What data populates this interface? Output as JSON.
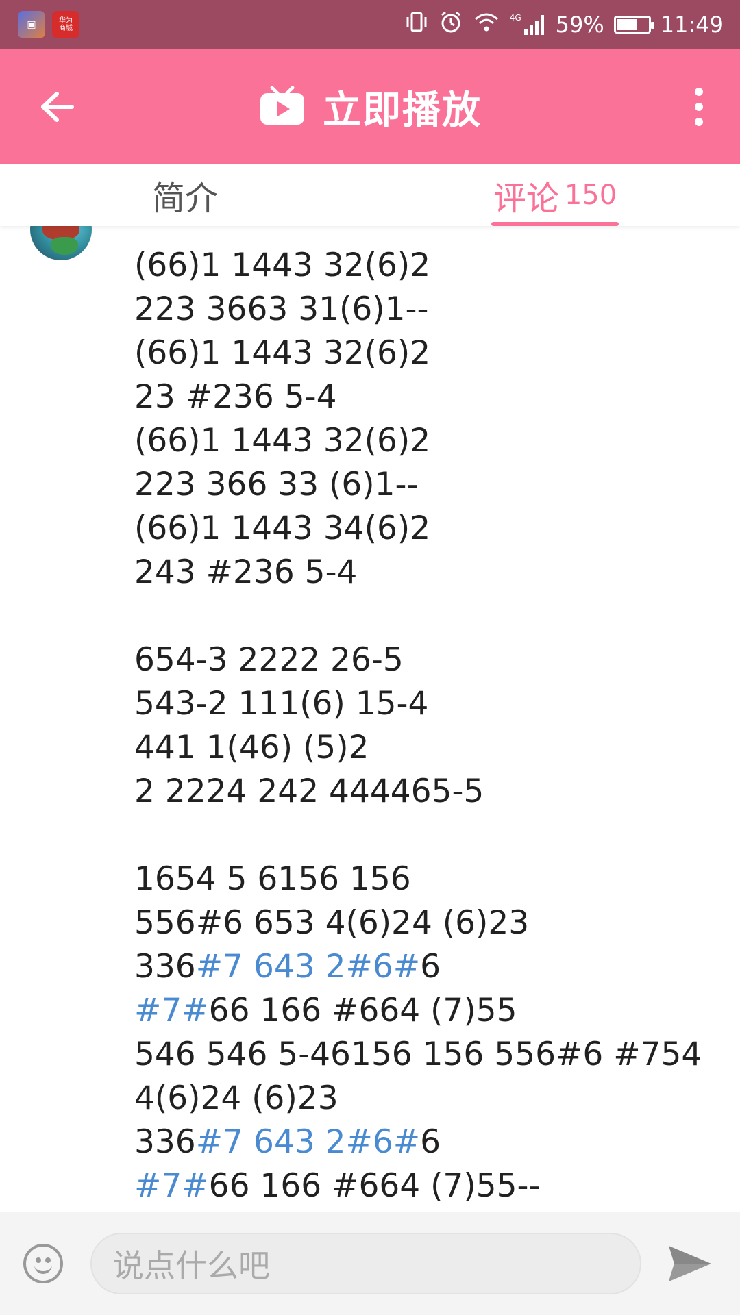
{
  "status_bar": {
    "notif_icon_b_text": "华为商城",
    "battery_percent": "59%",
    "battery_level": 0.59,
    "time": "11:49",
    "network": "4G",
    "icons": [
      "vibrate-icon",
      "alarm-icon",
      "wifi-icon",
      "signal-icon",
      "battery-icon"
    ]
  },
  "app_bar": {
    "title": "立即播放",
    "title_icon": "tv-play-icon",
    "back_icon": "arrow-left-icon",
    "more_icon": "more-vertical-icon",
    "bg_color": "#fb7299"
  },
  "tabs": {
    "intro": "简介",
    "comments": "评论",
    "comments_count": "150",
    "active": "comments"
  },
  "comment": {
    "lines": [
      "(66)1 1443 32(6)2",
      "223 3663 31(6)1--",
      "(66)1 1443 32(6)2",
      "23 #236 5-4",
      "(66)1 1443 32(6)2",
      "223 366 33 (6)1--",
      "(66)1 1443 34(6)2",
      "243 #236 5-4",
      "",
      "654-3 2222 26-5",
      "543-2 111(6) 15-4",
      "441 1(46) (5)2",
      "2 2224 242 444465-5",
      "",
      "1654 5 6156 156",
      "556#6 653 4(6)24 (6)23"
    ],
    "line17_a": "336",
    "line17_link": "#7 643 2#6#",
    "line17_b": "6",
    "line18_link": "#7#",
    "line18_b": "66 166 #664 (7)55",
    "line19": "546 546 5-46156 156 556#6 #754",
    "line20": "4(6)24 (6)23",
    "line21_a": "336",
    "line21_link": "#7 643 2#6#",
    "line21_b": "6",
    "line22_link": "#7#",
    "line22_b": "66 166 #664 (7)55--",
    "link_color": "#4a8ad0"
  },
  "input_bar": {
    "placeholder": "说点什么吧",
    "emoji_icon": "emoji-icon",
    "send_icon": "send-icon"
  }
}
